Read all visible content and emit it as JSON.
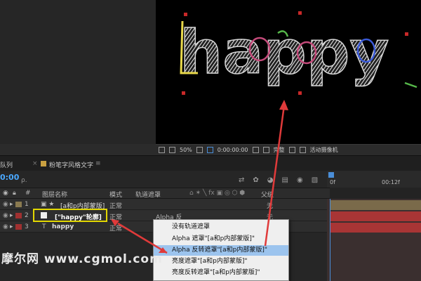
{
  "composition": {
    "text": "happy"
  },
  "viewer_bar": {
    "zoom": "50%",
    "timecode": "0:00:00:00",
    "quality": "完整",
    "camera": "活动摄像机"
  },
  "left_tab": "队列",
  "comp_tab": {
    "name": "粉笔字风格文字"
  },
  "timeline": {
    "timecode": "0:00",
    "search_placeholder": "ρ.",
    "ruler_labels": [
      "0f",
      "00:12f"
    ],
    "col_headers": {
      "layer_name": "图层名称",
      "mode": "模式",
      "track_matte": "轨道遮罩",
      "parent": "父级"
    }
  },
  "layers": [
    {
      "num": "1",
      "name": "[a和p内部蒙版]",
      "mode": "正常",
      "parent": "无",
      "matte": "",
      "color": "#8a7a50",
      "name_prefix": "▣ ★"
    },
    {
      "num": "2",
      "name": "[\"happy\"轮廓]",
      "mode": "正常",
      "parent": "无",
      "matte": "Alpha 反",
      "color": "#a03030",
      "name_prefix": ""
    },
    {
      "num": "3",
      "name": "happy",
      "mode": "正常",
      "parent": "无",
      "matte": "",
      "color": "#a03030",
      "name_prefix": "T"
    }
  ],
  "menu": {
    "items": [
      "没有轨道遮罩",
      "Alpha 遮罩\"[a和p内部蒙版]\"",
      "Alpha 反转遮罩\"[a和p内部蒙版]\"",
      "亮度遮罩\"[a和p内部蒙版]\"",
      "亮度反转遮罩\"[a和p内部蒙版]\""
    ],
    "selected_index": 2
  },
  "watermark": "摩尔网 www.cgmol.com",
  "colors": {
    "accent": "#4aa8ff",
    "highlight": "#e2d700",
    "arrow": "#e03a3a"
  }
}
